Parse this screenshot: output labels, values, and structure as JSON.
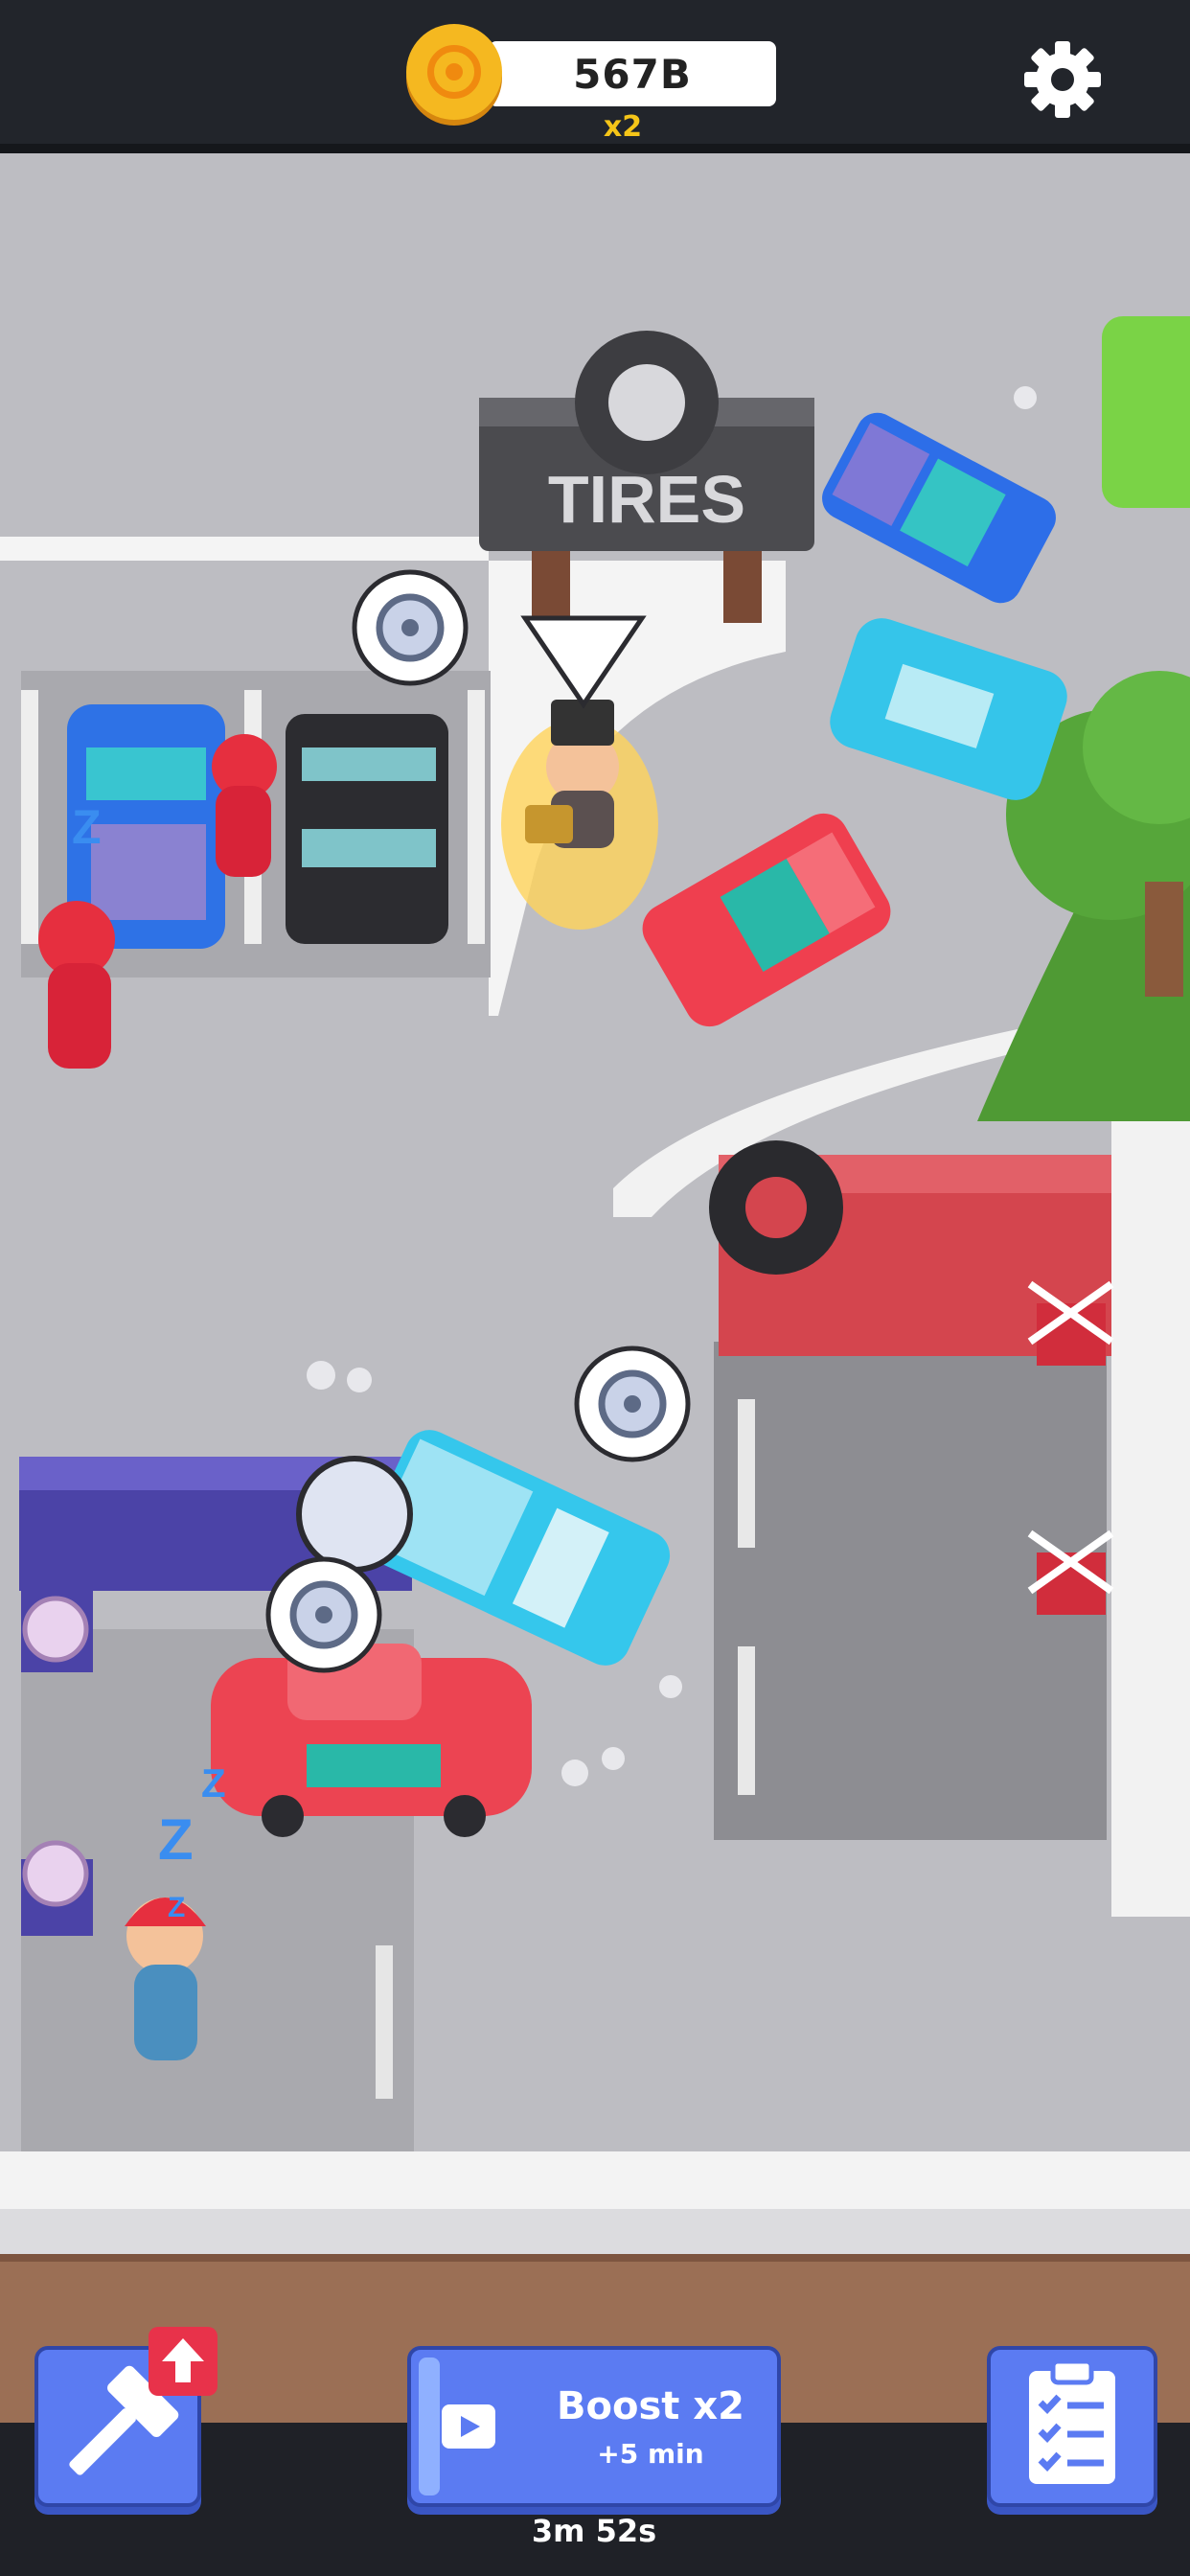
{
  "hud": {
    "currency_icon": "gold-coin-icon",
    "money": "567B",
    "multiplier": "x2",
    "settings_icon": "gear-icon"
  },
  "scene": {
    "sign_text": "TIRES",
    "sleep_glyph": "Z",
    "request_icon": "wheel-icon"
  },
  "controls": {
    "build_icon": "hammer-icon",
    "upgrade_icon": "arrow-up-icon",
    "boost_icon": "video-play-icon",
    "boost_label": "Boost x2",
    "boost_sub": "+5 min",
    "boost_timer": "3m 52s",
    "tasks_icon": "clipboard-checklist-icon"
  },
  "colors": {
    "topbar": "#22252b",
    "coin": "#f5b820",
    "multiplier": "#f5c518",
    "button_blue": "#5b7bf2",
    "upgrade_red": "#e8324a",
    "road": "#bdbdc2",
    "sidewalk": "#f3f3f3"
  }
}
